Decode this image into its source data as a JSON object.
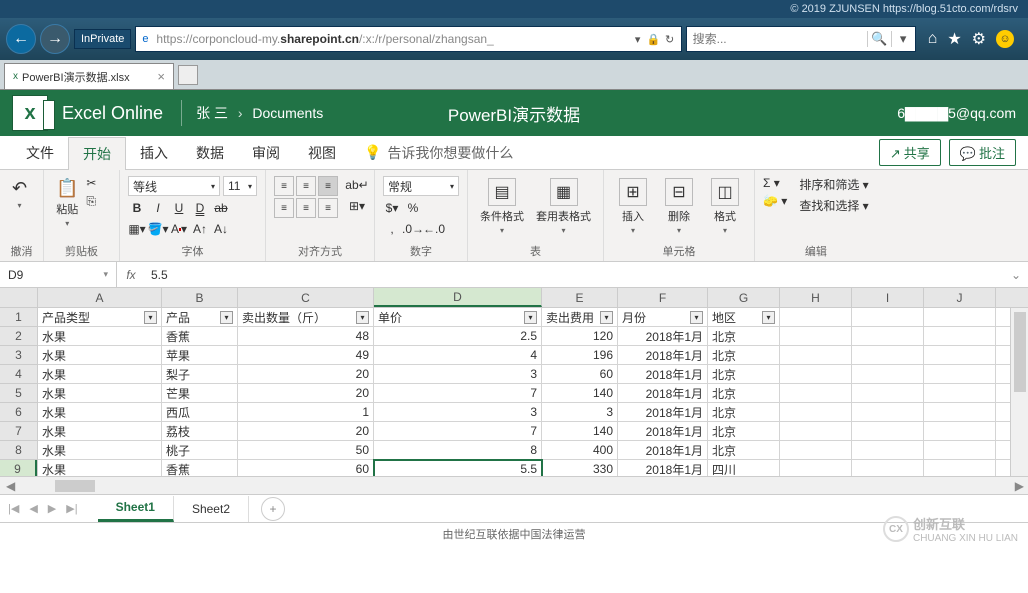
{
  "watermark": "© 2019 ZJUNSEN https://blog.51cto.com/rdsrv",
  "browser": {
    "inprivate_label": "InPrivate",
    "url_prefix": "https://",
    "url_host": "corponcloud-my.",
    "url_bold": "sharepoint.cn",
    "url_path": "/:x:/r/personal/zhangsan_",
    "search_placeholder": "搜索...",
    "tab_title": "PowerBI演示数据.xlsx"
  },
  "header": {
    "app_name": "Excel Online",
    "breadcrumb_user": "张 三",
    "breadcrumb_folder": "Documents",
    "doc_title": "PowerBI演示数据",
    "user_email": "6▇▇▇▇5@qq.com"
  },
  "ribbon_tabs": {
    "file": "文件",
    "home": "开始",
    "insert": "插入",
    "data": "数据",
    "review": "审阅",
    "view": "视图",
    "tellme": "告诉我你想要做什么",
    "share": "共享",
    "comment": "批注"
  },
  "ribbon_groups": {
    "undo": "撤消",
    "clipboard": "剪贴板",
    "paste": "粘贴",
    "font": "字体",
    "font_name": "等线",
    "font_size": "11",
    "alignment": "对齐方式",
    "number": "数字",
    "number_format": "常规",
    "tables": "表",
    "cond_format": "条件格式",
    "table_format": "套用表格式",
    "cells": "单元格",
    "insert": "插入",
    "delete": "删除",
    "format": "格式",
    "editing": "编辑",
    "sort_filter": "排序和筛选",
    "find_select": "查找和选择"
  },
  "formula_bar": {
    "name_box": "D9",
    "fx": "fx",
    "formula": "5.5"
  },
  "columns": [
    "A",
    "B",
    "C",
    "D",
    "E",
    "F",
    "G",
    "H",
    "I",
    "J"
  ],
  "headers": {
    "type": "产品类型",
    "product": "产品",
    "qty": "卖出数量（斤）",
    "price": "单价",
    "cost": "卖出费用",
    "month": "月份",
    "region": "地区"
  },
  "rows": [
    {
      "n": 1
    },
    {
      "n": 2,
      "type": "水果",
      "product": "香蕉",
      "qty": "48",
      "price": "2.5",
      "cost": "120",
      "month": "2018年1月",
      "region": "北京"
    },
    {
      "n": 3,
      "type": "水果",
      "product": "苹果",
      "qty": "49",
      "price": "4",
      "cost": "196",
      "month": "2018年1月",
      "region": "北京"
    },
    {
      "n": 4,
      "type": "水果",
      "product": "梨子",
      "qty": "20",
      "price": "3",
      "cost": "60",
      "month": "2018年1月",
      "region": "北京"
    },
    {
      "n": 5,
      "type": "水果",
      "product": "芒果",
      "qty": "20",
      "price": "7",
      "cost": "140",
      "month": "2018年1月",
      "region": "北京"
    },
    {
      "n": 6,
      "type": "水果",
      "product": "西瓜",
      "qty": "1",
      "price": "3",
      "cost": "3",
      "month": "2018年1月",
      "region": "北京"
    },
    {
      "n": 7,
      "type": "水果",
      "product": "荔枝",
      "qty": "20",
      "price": "7",
      "cost": "140",
      "month": "2018年1月",
      "region": "北京"
    },
    {
      "n": 8,
      "type": "水果",
      "product": "桃子",
      "qty": "50",
      "price": "8",
      "cost": "400",
      "month": "2018年1月",
      "region": "北京"
    },
    {
      "n": 9,
      "type": "水果",
      "product": "香蕉",
      "qty": "60",
      "price": "5.5",
      "cost": "330",
      "month": "2018年1月",
      "region": "四川"
    }
  ],
  "sheets": {
    "s1": "Sheet1",
    "s2": "Sheet2"
  },
  "footer": {
    "legal": "由世纪互联依据中国法律运营",
    "logo_text": "创新互联",
    "logo_sub": "CHUANG XIN HU LIAN"
  }
}
